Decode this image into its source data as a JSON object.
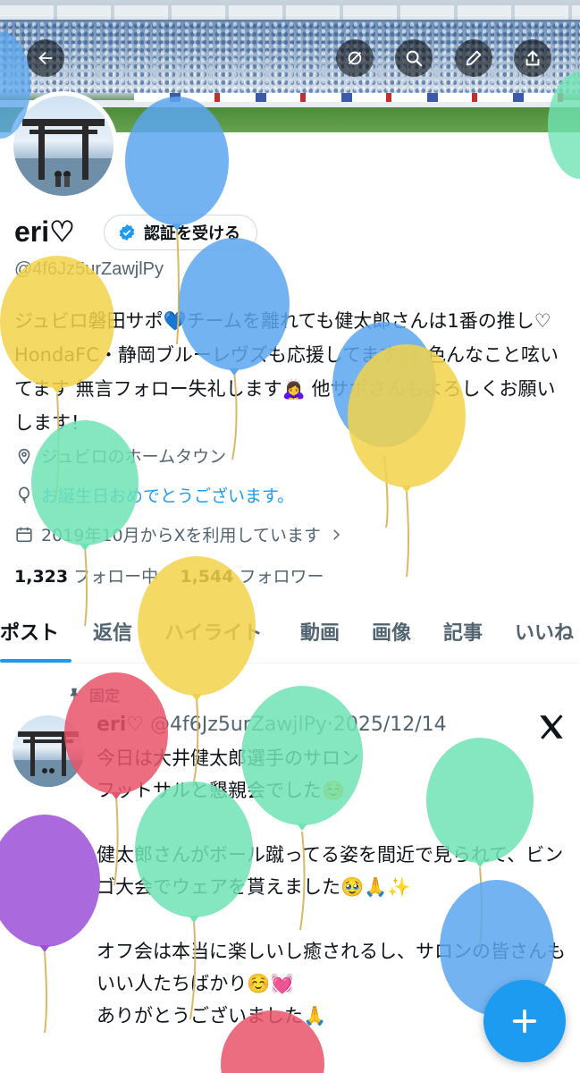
{
  "header": {
    "back_icon": "arrow-left-icon",
    "actions": [
      "mute-icon",
      "search-icon",
      "edit-icon",
      "share-icon"
    ]
  },
  "profile": {
    "display_name": "eri♡",
    "verify_label": "認証を受ける",
    "handle": "@4f6Jz5urZawjlPy",
    "bio": "ジュビロ磐田サポ💙チームを離れても健太郎さんは1番の推し♡ HondaFC・静岡ブルーレヴズも応援してます🙌🏻 色んなこと呟いてます 無言フォロー失礼します🙇‍♀️ 他サポさんもよろしくお願いします！",
    "location": "ジュビロのホームタウン",
    "birthday": "お誕生日おめでとうございます。",
    "joined": "2019年10月からXを利用しています",
    "following_count": "1,323",
    "following_label": "フォロー中",
    "followers_count": "1,544",
    "followers_label": "フォロワー"
  },
  "tabs": [
    {
      "label": "ポスト",
      "active": true
    },
    {
      "label": "返信",
      "active": false
    },
    {
      "label": "ハイライト",
      "active": false
    },
    {
      "label": "動画",
      "active": false
    },
    {
      "label": "画像",
      "active": false
    },
    {
      "label": "記事",
      "active": false
    },
    {
      "label": "いいね",
      "active": false
    }
  ],
  "post": {
    "pinned_label": "固定",
    "author": "eri♡",
    "handle": "@4f6Jz5urZawjlPy",
    "sep": "·",
    "date": "2025/12/14",
    "text": "今日は大井健太郎選手のサロン\nフットサルと懇親会でした☺️\n\n健太郎さんがボール蹴ってる姿を間近で見られて、ビンゴ大会でウェアを貰えました🥹🙏✨\n\nオフ会は本当に楽しいし癒されるし、サロンの皆さんもいい人たちばかり☺️💓\nありがとうございました🙏"
  },
  "colors": {
    "accent": "#1d9bf0",
    "balloon_blue": "#5aa6ee",
    "balloon_yellow": "#f2d24a",
    "balloon_green": "#6fe3b4",
    "balloon_red": "#e9536a",
    "balloon_purple": "#9b4fd6"
  },
  "fab_icon": "plus-icon"
}
